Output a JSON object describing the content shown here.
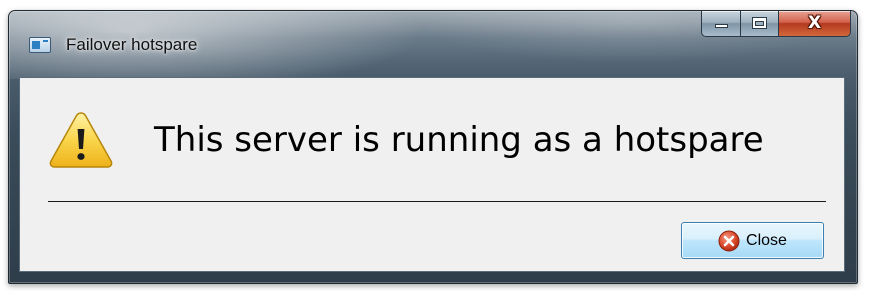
{
  "window": {
    "title": "Failover hotspare",
    "icon": "app-window-icon"
  },
  "caption_buttons": {
    "minimize_icon": "minimize-icon",
    "maximize_icon": "maximize-icon",
    "close_icon": "close-icon",
    "close_glyph": "X"
  },
  "dialog": {
    "icon": "warning-icon",
    "message": "This server is running as a hotspare",
    "close_button": {
      "label": "Close",
      "icon": "close-circle-icon"
    }
  },
  "colors": {
    "warning_yellow": "#f6c736",
    "close_red": "#d9472b",
    "button_blue": "#bee6fd"
  }
}
